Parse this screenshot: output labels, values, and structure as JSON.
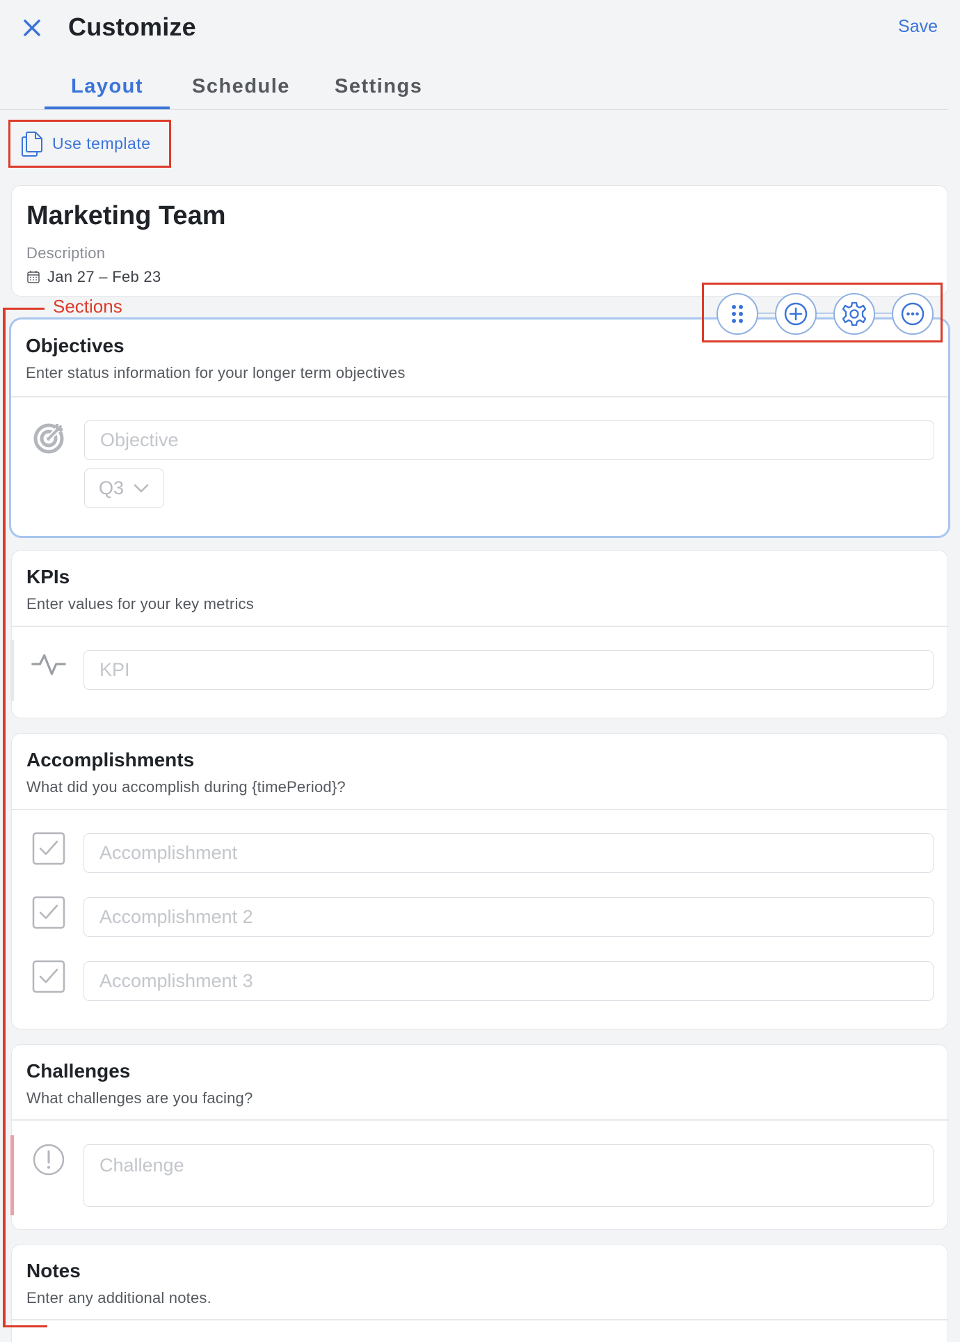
{
  "header": {
    "title": "Customize",
    "save_label": "Save"
  },
  "tabs": [
    {
      "label": "Layout",
      "active": true
    },
    {
      "label": "Schedule",
      "active": false
    },
    {
      "label": "Settings",
      "active": false
    }
  ],
  "use_template_label": "Use template",
  "report": {
    "title": "Marketing Team",
    "description": "Description",
    "date_range": "Jan 27 – Feb 23"
  },
  "annotation": {
    "sections_label": "Sections"
  },
  "sections": {
    "objectives": {
      "title": "Objectives",
      "subtitle": "Enter status information for your longer term objectives",
      "placeholder": "Objective",
      "quarter": "Q3"
    },
    "kpis": {
      "title": "KPIs",
      "subtitle": "Enter values for your key metrics",
      "placeholder": "KPI"
    },
    "accomplishments": {
      "title": "Accomplishments",
      "subtitle": "What did you accomplish during {timePeriod}?",
      "items": [
        "Accomplishment",
        "Accomplishment 2",
        "Accomplishment 3"
      ]
    },
    "challenges": {
      "title": "Challenges",
      "subtitle": "What challenges are you facing?",
      "placeholder": "Challenge"
    },
    "notes": {
      "title": "Notes",
      "subtitle": "Enter any additional notes."
    }
  },
  "colors": {
    "accent": "#3b74d9",
    "annotation": "#dd3b2a",
    "selection": "#a8c6ef",
    "challenge_marker": "#e8a3aa"
  }
}
